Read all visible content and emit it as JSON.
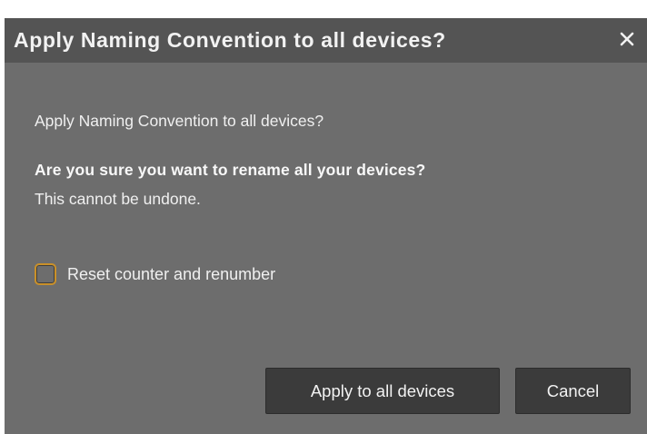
{
  "dialog": {
    "title": "Apply Naming Convention to all devices?",
    "close_icon": "close-icon",
    "prompt": "Apply Naming Convention to all devices?",
    "confirm_question": "Are you sure you want to rename all your devices?",
    "warning": "This cannot be undone.",
    "checkbox": {
      "label": "Reset counter and renumber",
      "checked": false
    },
    "buttons": {
      "apply_label": "Apply to all devices",
      "cancel_label": "Cancel"
    }
  },
  "colors": {
    "body_bg": "#6d6d6d",
    "titlebar_bg": "#545454",
    "button_bg": "#3b3b3b",
    "checkbox_focus": "#c9902a",
    "text": "#f0f0f0"
  }
}
